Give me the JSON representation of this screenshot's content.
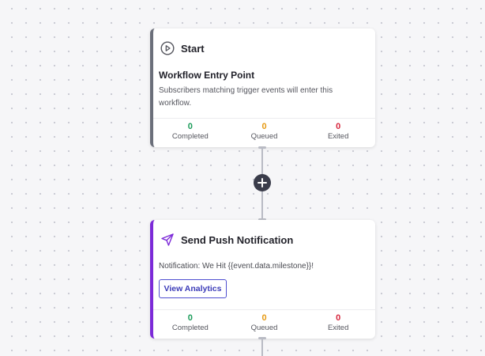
{
  "start_node": {
    "title": "Start",
    "icon": "play-circle-icon",
    "entry_title": "Workflow Entry Point",
    "description": "Subscribers matching trigger events will enter this workflow.",
    "accent_color": "#6b6f7a",
    "stats": {
      "completed_value": "0",
      "completed_label": "Completed",
      "queued_value": "0",
      "queued_label": "Queued",
      "exited_value": "0",
      "exited_label": "Exited"
    }
  },
  "connector": {
    "add_icon": "plus-icon"
  },
  "push_node": {
    "title": "Send Push Notification",
    "icon": "send-icon",
    "notification_text": "Notification: We Hit {{event.data.milestone}}!",
    "view_analytics_label": "View Analytics",
    "accent_color": "#7c2ad8",
    "stats": {
      "completed_value": "0",
      "completed_label": "Completed",
      "queued_value": "0",
      "queued_label": "Queued",
      "exited_value": "0",
      "exited_label": "Exited"
    }
  },
  "colors": {
    "completed": "#1a9b59",
    "queued": "#e69a13",
    "exited": "#d7263d",
    "button": "#3b3bb8"
  }
}
